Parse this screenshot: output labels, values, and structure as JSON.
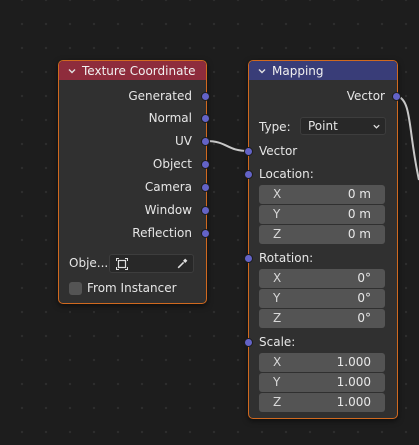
{
  "texture_coordinate_node": {
    "title": "Texture Coordinate",
    "header_color": "#8e2c3c",
    "outputs": [
      "Generated",
      "Normal",
      "UV",
      "Object",
      "Camera",
      "Window",
      "Reflection"
    ],
    "object_label": "Obje...",
    "from_instancer_label": "From Instancer",
    "from_instancer_checked": false
  },
  "mapping_node": {
    "title": "Mapping",
    "header_color": "#393d78",
    "output_label": "Vector",
    "type_label": "Type:",
    "type_value": "Point",
    "vector_input_label": "Vector",
    "location_label": "Location:",
    "location": [
      {
        "axis": "X",
        "value": "0 m"
      },
      {
        "axis": "Y",
        "value": "0 m"
      },
      {
        "axis": "Z",
        "value": "0 m"
      }
    ],
    "rotation_label": "Rotation:",
    "rotation": [
      {
        "axis": "X",
        "value": "0°"
      },
      {
        "axis": "Y",
        "value": "0°"
      },
      {
        "axis": "Z",
        "value": "0°"
      }
    ],
    "scale_label": "Scale:",
    "scale": [
      {
        "axis": "X",
        "value": "1.000"
      },
      {
        "axis": "Y",
        "value": "1.000"
      },
      {
        "axis": "Z",
        "value": "1.000"
      }
    ]
  },
  "colors": {
    "node_border_selected": "#d0691f",
    "socket_vector": "#6363c7",
    "link": "#c8c8c8"
  }
}
